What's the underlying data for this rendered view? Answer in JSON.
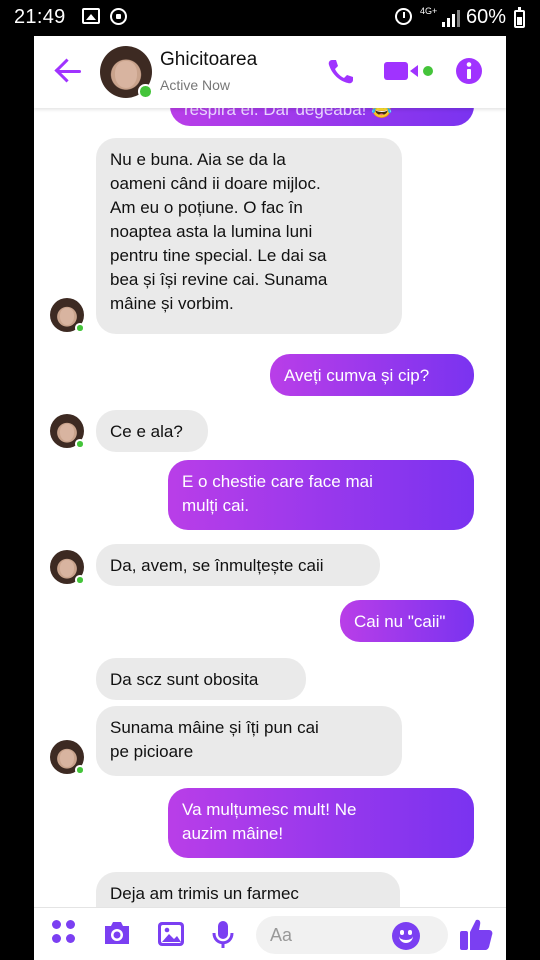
{
  "status_bar": {
    "time": "21:49",
    "network": "4G+",
    "battery": "60%"
  },
  "header": {
    "contact_name": "Ghicitoarea",
    "status": "Active Now",
    "accent": "#a033ff"
  },
  "messages": [
    {
      "side": "out",
      "text": "respira el. Dar degeaba! 😂",
      "partial": true
    },
    {
      "side": "in",
      "text": "Nu e buna. Aia se da la\noameni când ii doare mijloc.\nAm eu o poțiune. O fac în\nnoaptea asta la lumina luni\npentru tine special. Le dai sa\nbea și își revine cai. Sunama\nmâine și vorbim."
    },
    {
      "side": "out",
      "text": "Aveți cumva și cip?"
    },
    {
      "side": "in",
      "text": "Ce e ala?"
    },
    {
      "side": "out",
      "text": "E o chestie care face mai\nmulți cai."
    },
    {
      "side": "in",
      "text": "Da, avem, se înmulțește caii"
    },
    {
      "side": "out",
      "text": "Cai nu \"caii\""
    },
    {
      "side": "in",
      "text": "Da scz sunt obosita"
    },
    {
      "side": "in",
      "text": "Sunama mâine și îți pun cai\npe picioare"
    },
    {
      "side": "out",
      "text": "Va mulțumesc mult! Ne\nauzim mâine!"
    },
    {
      "side": "in",
      "text": "Deja am trimis un farmec",
      "partial": true
    }
  ],
  "composer": {
    "placeholder": "Aa"
  },
  "colors": {
    "incoming_bubble": "#eaeaea",
    "outgoing_start": "#b93ee8",
    "outgoing_end": "#7a33f0",
    "online_dot": "#44c43a",
    "icon": "#7b3ff2"
  },
  "icons": [
    "arrow-left",
    "phone",
    "video-camera",
    "info",
    "grid-dots",
    "camera",
    "image",
    "microphone",
    "emoji",
    "thumbs-up"
  ]
}
